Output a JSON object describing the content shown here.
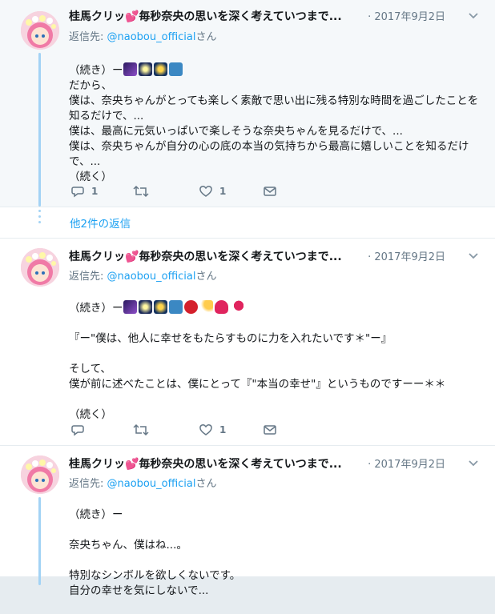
{
  "colors": {
    "accent": "#1da1f2",
    "muted": "#657786",
    "thread": "#a3d3f5",
    "like": "#e0245e"
  },
  "tweets": [
    {
      "name": "桂馬クリッ💕毎秒奈央の思いを深く考えていつまで...",
      "time": "· 2017年9月2日",
      "reply_prefix": "返信先: ",
      "reply_handle": "@naobou_official",
      "reply_suffix": "さん",
      "body_start": "（続き）ー",
      "emojis": [
        "milky-way",
        "sparkler",
        "fireworks",
        "kimono"
      ],
      "body_rest": "だから、\n僕は、奈央ちゃんがとっても楽しく素敵で思い出に残る特別な時間を過ごしたことを知るだけで、...\n僕は、最高に元気いっぱいで楽しそうな奈央ちゃんを見るだけで、...\n僕は、奈央ちゃんが自分の心の底の本当の気持ちから最高に嬉しいことを知るだけで、...\n（続く）",
      "reply_count": "1",
      "retweet_count": "",
      "like_count": "1"
    },
    {
      "name": "桂馬クリッ💕毎秒奈央の思いを深く考えていつまで...",
      "time": "· 2017年9月2日",
      "reply_prefix": "返信先: ",
      "reply_handle": "@naobou_official",
      "reply_suffix": "さん",
      "body_start": "（続き）ー",
      "emojis": [
        "milky-way",
        "sparkler",
        "fireworks",
        "kimono",
        "lantern",
        "shooting-star",
        "sparkling-heart",
        "two-hearts"
      ],
      "body_rest": "\n『ー\"僕は、他人に幸せをもたらすものに力を入れたいです＊\"ー』\n\nそして、\n僕が前に述べたことは、僕にとって『\"本当の幸せ\"』というものですーー＊＊\n\n（続く）",
      "reply_count": "",
      "retweet_count": "",
      "like_count": "1"
    },
    {
      "name": "桂馬クリッ💕毎秒奈央の思いを深く考えていつまで...",
      "time": "· 2017年9月2日",
      "reply_prefix": "返信先: ",
      "reply_handle": "@naobou_official",
      "reply_suffix": "さん",
      "body_start": "（続き）ー",
      "emojis": [],
      "body_rest": "\n奈央ちゃん、僕はね...。\n\n特別なシンボルを欲しくないです。\n自分の幸せを気にしないで..."
    }
  ],
  "more_replies": "他2件の返信"
}
